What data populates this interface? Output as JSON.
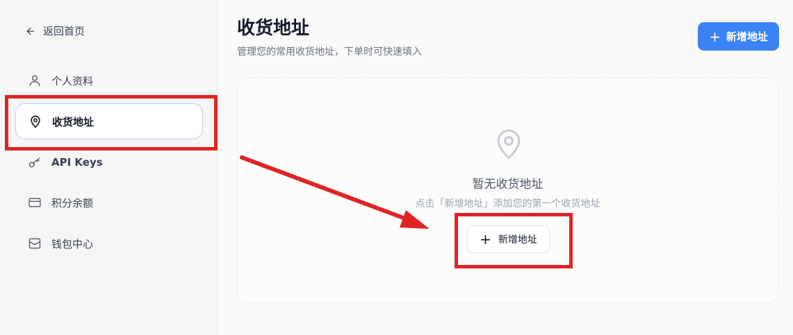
{
  "sidebar": {
    "back_label": "返回首页",
    "items": [
      {
        "label": "个人资料",
        "icon": "user-icon"
      },
      {
        "label": "收货地址",
        "icon": "map-pin-icon",
        "active": true
      },
      {
        "label": "API Keys",
        "icon": "key-icon"
      },
      {
        "label": "积分余额",
        "icon": "credit-card-icon"
      },
      {
        "label": "钱包中心",
        "icon": "wallet-icon"
      }
    ]
  },
  "header": {
    "title": "收货地址",
    "subtitle": "管理您的常用收货地址，下单时可快速填入",
    "add_button_label": "新增地址"
  },
  "empty_state": {
    "icon": "map-pin-icon",
    "title": "暂无收货地址",
    "hint": "点击「新增地址」添加您的第一个收货地址",
    "button_label": "新增地址"
  },
  "colors": {
    "primary": "#3b82f6",
    "annotation": "#e02424",
    "active_border": "#b9cdf0"
  }
}
